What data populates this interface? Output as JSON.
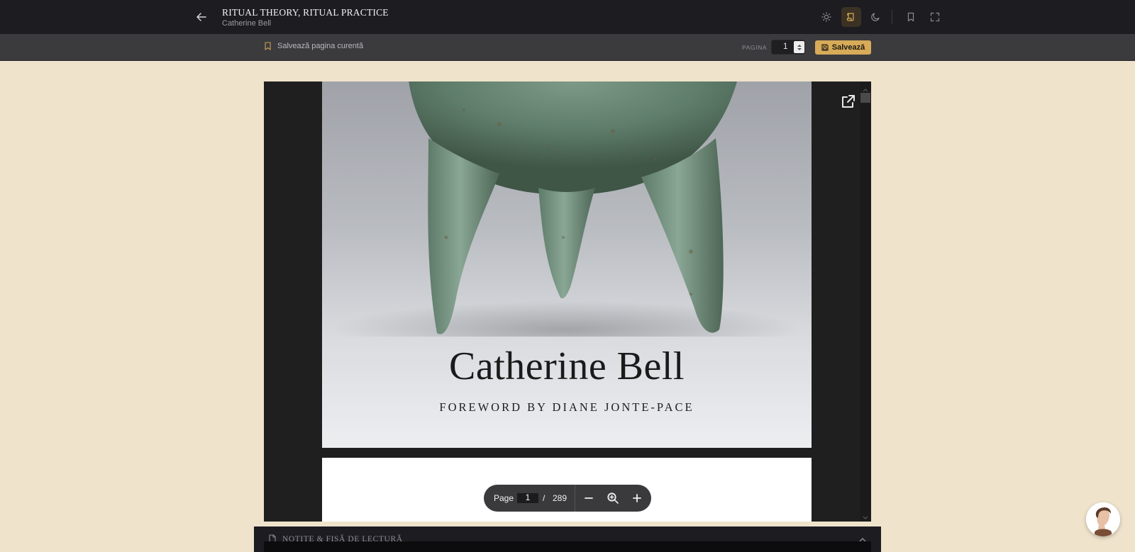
{
  "header": {
    "back_icon": "arrow-left-icon",
    "title": "RITUAL THEORY, RITUAL PRACTICE",
    "author": "Catherine Bell",
    "tools": [
      {
        "name": "light-theme",
        "icon": "sun-icon",
        "active": false
      },
      {
        "name": "sepia-theme",
        "icon": "scroll-icon",
        "active": true
      },
      {
        "name": "dark-theme",
        "icon": "moon-icon",
        "active": false
      },
      {
        "name": "bookmark",
        "icon": "bookmark-icon",
        "active": false
      },
      {
        "name": "fullscreen",
        "icon": "fullscreen-icon",
        "active": false
      }
    ]
  },
  "toolbar": {
    "save_current_label": "Salvează pagina curentă",
    "page_label": "PAGINA",
    "page_value": "1",
    "save_label": "Salvează"
  },
  "viewer": {
    "cover_author": "Catherine Bell",
    "cover_foreword": "FOREWORD BY DIANE JONTE-PACE",
    "controls": {
      "page_label": "Page",
      "current_page": "1",
      "separator": "/",
      "total_pages": "289"
    }
  },
  "notes": {
    "title": "NOTIȚE & FIȘĂ DE LECTURĂ"
  },
  "colors": {
    "accent": "#d8ab59",
    "background": "#efe3cc",
    "topbar": "#1c1c21"
  }
}
